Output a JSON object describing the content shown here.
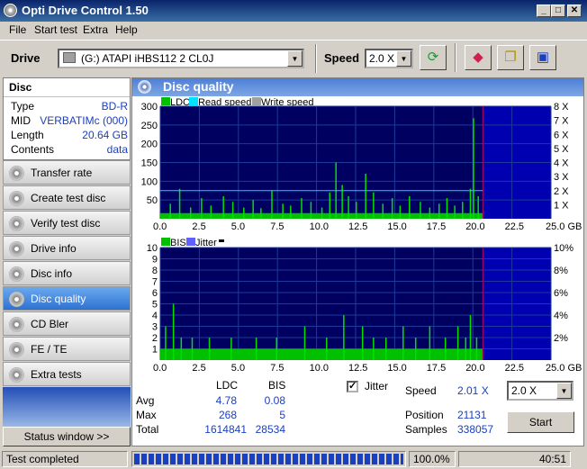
{
  "window": {
    "title": "Opti Drive Control 1.50"
  },
  "menu": [
    "File",
    "Start test",
    "Extra",
    "Help"
  ],
  "toolbar": {
    "drive_label": "Drive",
    "drive_value": "(G:)  ATAPI iHBS112  2 CL0J",
    "speed_label": "Speed",
    "speed_value": "2.0 X"
  },
  "disc": {
    "header": "Disc",
    "rows": [
      {
        "key": "Type",
        "value": "BD-R"
      },
      {
        "key": "MID",
        "value": "VERBATIMc (000)"
      },
      {
        "key": "Length",
        "value": "20.64 GB"
      },
      {
        "key": "Contents",
        "value": "data"
      }
    ]
  },
  "nav": [
    {
      "label": "Transfer rate",
      "active": false
    },
    {
      "label": "Create test disc",
      "active": false
    },
    {
      "label": "Verify test disc",
      "active": false
    },
    {
      "label": "Drive info",
      "active": false
    },
    {
      "label": "Disc info",
      "active": false
    },
    {
      "label": "Disc quality",
      "active": true
    },
    {
      "label": "CD Bler",
      "active": false
    },
    {
      "label": "FE / TE",
      "active": false
    },
    {
      "label": "Extra tests",
      "active": false
    }
  ],
  "status_window_label": "Status window >>",
  "panel_title": "Disc quality",
  "chart_data": [
    {
      "type": "bar",
      "legend": [
        "LDC",
        "Read speed",
        "Write speed"
      ],
      "colors": {
        "LDC": "#00c000",
        "Read speed": "#00e0ff",
        "Write speed": "#a0a0a0",
        "background": "#000060",
        "grid": "#1e3a9a"
      },
      "xlim": [
        0,
        25
      ],
      "ylim": [
        0,
        300
      ],
      "y2lim": [
        0,
        8
      ],
      "x_ticks": [
        "0.0",
        "2.5",
        "5.0",
        "7.5",
        "10.0",
        "12.5",
        "15.0",
        "17.5",
        "20.0",
        "22.5",
        "25.0 GB"
      ],
      "y_ticks": [
        "50",
        "100",
        "150",
        "200",
        "250",
        "300"
      ],
      "y2_ticks": [
        "1 X",
        "2 X",
        "3 X",
        "4 X",
        "5 X",
        "6 X",
        "7 X",
        "8 X"
      ],
      "data_end_gb": 20.64,
      "baseline": 15,
      "read_speed_x": 2.0,
      "spikes": [
        [
          0.6,
          40
        ],
        [
          1.2,
          80
        ],
        [
          1.9,
          30
        ],
        [
          2.6,
          55
        ],
        [
          3.2,
          35
        ],
        [
          4.0,
          60
        ],
        [
          4.6,
          45
        ],
        [
          5.3,
          30
        ],
        [
          5.9,
          50
        ],
        [
          6.4,
          28
        ],
        [
          7.1,
          75
        ],
        [
          7.8,
          40
        ],
        [
          8.3,
          35
        ],
        [
          9.0,
          55
        ],
        [
          9.6,
          45
        ],
        [
          10.3,
          30
        ],
        [
          10.8,
          70
        ],
        [
          11.2,
          150
        ],
        [
          11.6,
          90
        ],
        [
          12.0,
          60
        ],
        [
          12.5,
          45
        ],
        [
          13.1,
          120
        ],
        [
          13.6,
          70
        ],
        [
          14.2,
          40
        ],
        [
          14.8,
          55
        ],
        [
          15.3,
          35
        ],
        [
          15.9,
          60
        ],
        [
          16.6,
          45
        ],
        [
          17.2,
          30
        ],
        [
          17.8,
          40
        ],
        [
          18.3,
          55
        ],
        [
          18.8,
          35
        ],
        [
          19.3,
          45
        ],
        [
          19.8,
          80
        ],
        [
          20.0,
          268
        ],
        [
          20.3,
          60
        ]
      ]
    },
    {
      "type": "bar",
      "legend": [
        "BIS",
        "Jitter"
      ],
      "colors": {
        "BIS": "#00c000",
        "Jitter": "#6060ff",
        "background": "#000060",
        "grid": "#1e3a9a"
      },
      "xlim": [
        0,
        25
      ],
      "ylim": [
        0,
        10
      ],
      "y2lim": [
        0,
        10
      ],
      "x_ticks": [
        "0.0",
        "2.5",
        "5.0",
        "7.5",
        "10.0",
        "12.5",
        "15.0",
        "17.5",
        "20.0",
        "22.5",
        "25.0 GB"
      ],
      "y_ticks": [
        "1",
        "2",
        "3",
        "4",
        "5",
        "6",
        "7",
        "8",
        "9",
        "10"
      ],
      "y2_ticks": [
        "2%",
        "4%",
        "6%",
        "8%",
        "10%"
      ],
      "data_end_gb": 20.64,
      "baseline": 1,
      "spikes": [
        [
          0.3,
          3
        ],
        [
          0.8,
          5
        ],
        [
          1.3,
          2
        ],
        [
          2.0,
          2
        ],
        [
          3.1,
          2
        ],
        [
          4.5,
          2
        ],
        [
          6.1,
          2
        ],
        [
          7.4,
          2
        ],
        [
          9.2,
          3
        ],
        [
          10.6,
          2
        ],
        [
          11.7,
          4
        ],
        [
          12.9,
          3
        ],
        [
          13.6,
          2
        ],
        [
          14.4,
          2
        ],
        [
          15.5,
          3
        ],
        [
          16.3,
          2
        ],
        [
          17.2,
          3
        ],
        [
          18.2,
          2
        ],
        [
          19.0,
          3
        ],
        [
          19.5,
          2
        ],
        [
          19.8,
          4
        ],
        [
          20.2,
          2
        ]
      ]
    }
  ],
  "stats": {
    "col_ldc": "LDC",
    "col_bis": "BIS",
    "rows": [
      {
        "label": "Avg",
        "ldc": "4.78",
        "bis": "0.08"
      },
      {
        "label": "Max",
        "ldc": "268",
        "bis": "5"
      },
      {
        "label": "Total",
        "ldc": "1614841",
        "bis": "28534"
      }
    ],
    "jitter_label": "Jitter",
    "jitter_checked": true,
    "speed_label": "Speed",
    "speed_value": "2.01 X",
    "speed_select": "2.0 X",
    "position_label": "Position",
    "position_value": "21131",
    "samples_label": "Samples",
    "samples_value": "338057",
    "start_label": "Start"
  },
  "statusbar": {
    "text": "Test completed",
    "progress": 1.0,
    "percent": "100.0%",
    "time": "40:51"
  }
}
